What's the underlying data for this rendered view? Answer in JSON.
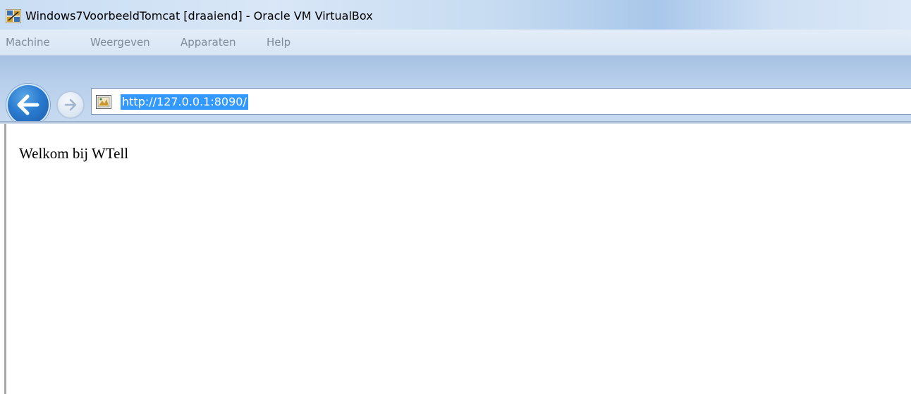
{
  "window": {
    "title": "Windows7VoorbeeldTomcat [draaiend] - Oracle VM VirtualBox",
    "icon": "virtualbox-icon"
  },
  "menubar": {
    "items": [
      {
        "label": "Machine"
      },
      {
        "label": "Weergeven"
      },
      {
        "label": "Apparaten"
      },
      {
        "label": "Help"
      }
    ]
  },
  "browser": {
    "back_icon": "back-arrow-icon",
    "forward_icon": "forward-arrow-icon",
    "page_icon": "page-favicon-icon",
    "url": "http://127.0.0.1:8090/"
  },
  "page": {
    "welcome_text": "Welkom bij WTell"
  },
  "colors": {
    "selection": "#3399ff",
    "back_button": "#2a7bd0",
    "menu_text": "#7f8b99"
  }
}
